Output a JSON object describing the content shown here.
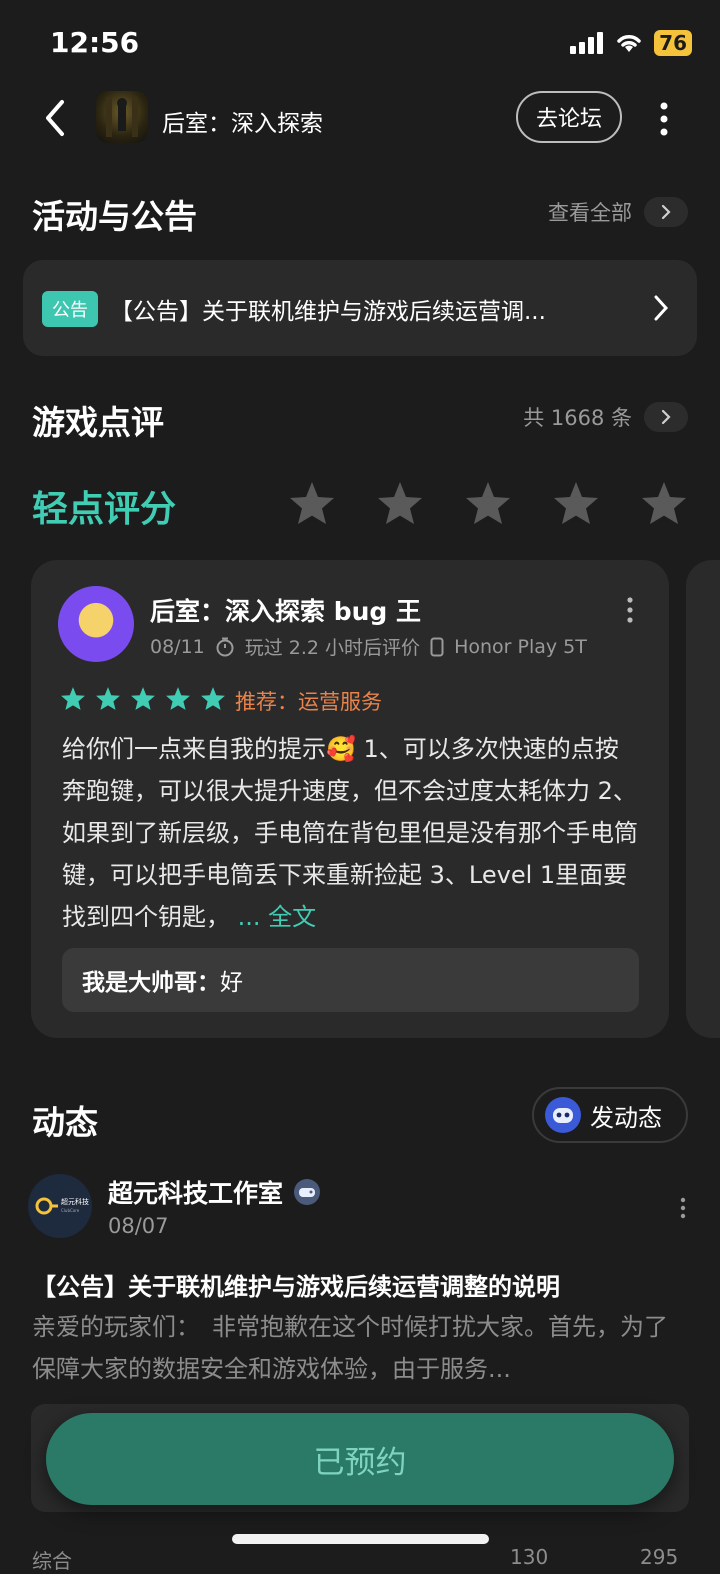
{
  "status_bar": {
    "time": "12:56",
    "battery": "76"
  },
  "header": {
    "game_title": "后室：深入探索",
    "forum_button": "去论坛"
  },
  "activities": {
    "title": "活动与公告",
    "view_all": "查看全部",
    "notice_badge": "公告",
    "notice_text": "【公告】关于联机维护与游戏后续运营调..."
  },
  "reviews": {
    "title": "游戏点评",
    "count": "共 1668 条",
    "rating_label": "轻点评分",
    "card": {
      "title": "后室：深入探索 bug 王",
      "date": "08/11",
      "played": "玩过 2.2 小时后评价",
      "device": "Honor Play 5T",
      "recommend": "推荐：运营服务",
      "stars": 5,
      "body": "给你们一点来自我的提示🥰 1、可以多次快速的点按奔跑键，可以很大提升速度，但不会过度太耗体力 2、如果到了新层级，手电筒在背包里但是没有那个手电筒键，可以把手电筒丢下来重新捡起 3、Level 1里面要找到四个钥匙，",
      "full_text": "... 全文",
      "reply_user": "我是大帅哥：",
      "reply_text": "好"
    }
  },
  "feed": {
    "title": "动态",
    "post_button": "发动态",
    "post": {
      "author": "超元科技工作室",
      "date": "08/07",
      "title": "【公告】关于联机维护与游戏后续运营调整的说明",
      "body": "亲爱的玩家们：　非常抱歉在这个时候打扰大家。首先，为了保障大家的数据安全和游戏体验，由于服务..."
    }
  },
  "reserve_button": "已预约",
  "bottom": {
    "left": "综合",
    "comments": "130",
    "likes": "295"
  },
  "colors": {
    "accent": "#40cdb4",
    "recommend": "#e8834b",
    "reserve_bg": "#2a7a67"
  }
}
